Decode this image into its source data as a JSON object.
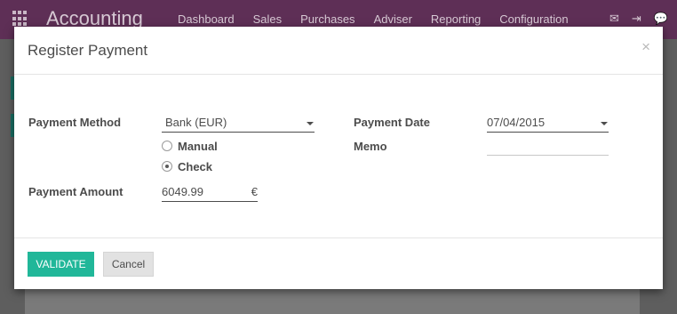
{
  "navbar": {
    "brand": "Accounting",
    "menu": [
      "Dashboard",
      "Sales",
      "Purchases",
      "Adviser",
      "Reporting",
      "Configuration"
    ],
    "icons": [
      "envelope-icon",
      "sign-in-icon",
      "chat-icon"
    ]
  },
  "modal": {
    "title": "Register Payment",
    "close_glyph": "×"
  },
  "form": {
    "payment_method": {
      "label": "Payment Method",
      "value": "Bank (EUR)"
    },
    "payment_type_options": [
      {
        "label": "Manual",
        "checked": false
      },
      {
        "label": "Check",
        "checked": true
      }
    ],
    "payment_amount": {
      "label": "Payment Amount",
      "value": "6049.99",
      "currency": "€"
    },
    "payment_date": {
      "label": "Payment Date",
      "value": "07/04/2015"
    },
    "memo": {
      "label": "Memo",
      "value": ""
    }
  },
  "footer": {
    "validate_label": "VALIDATE",
    "cancel_label": "Cancel"
  }
}
